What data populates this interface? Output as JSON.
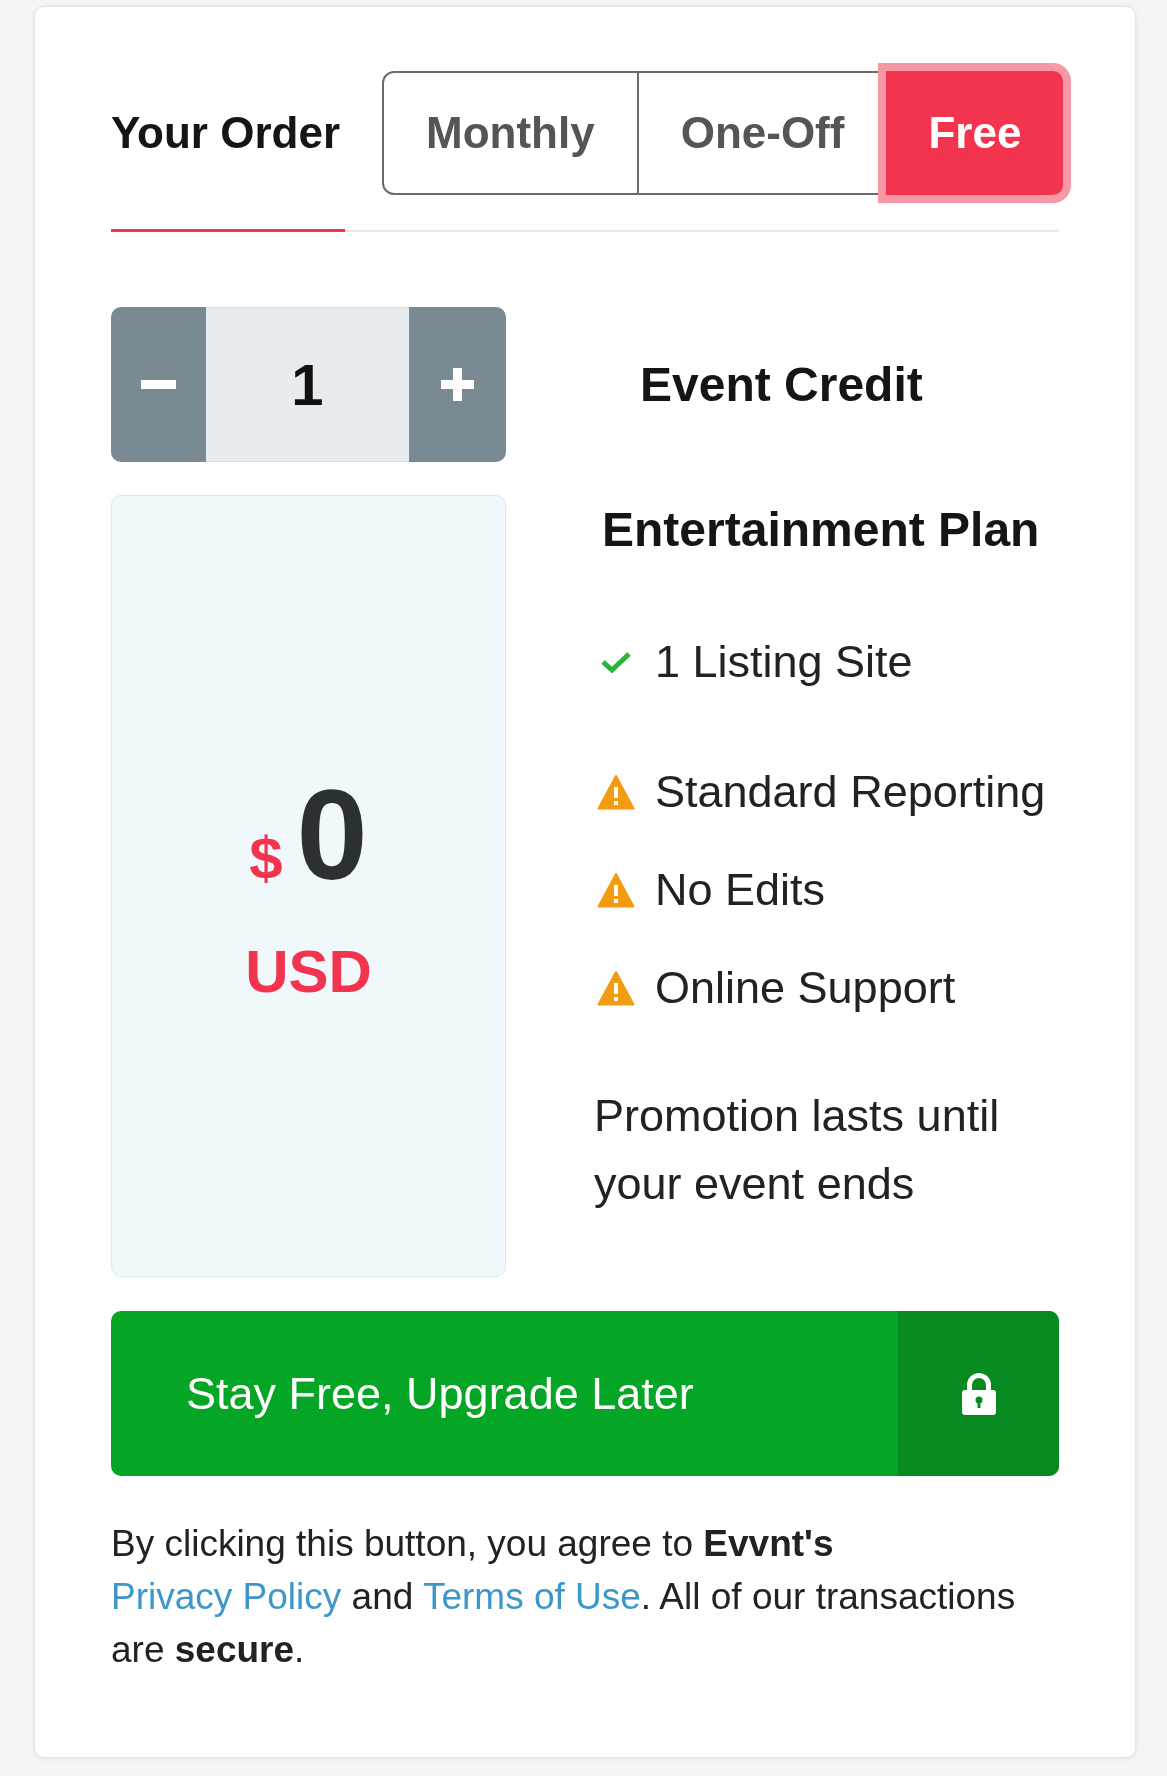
{
  "header": {
    "title": "Your Order"
  },
  "tabs": [
    {
      "label": "Monthly",
      "selected": false
    },
    {
      "label": "One-Off",
      "selected": false
    },
    {
      "label": "Free",
      "selected": true
    }
  ],
  "quantity": {
    "value": "1"
  },
  "product": {
    "title": "Event Credit"
  },
  "price": {
    "currency_symbol": "$",
    "amount": "0",
    "currency": "USD"
  },
  "plan": {
    "title": "Entertainment Plan",
    "features": [
      {
        "kind": "included",
        "text": "1 Listing Site"
      },
      {
        "kind": "limited",
        "text": "Standard Reporting"
      },
      {
        "kind": "limited",
        "text": "No Edits"
      },
      {
        "kind": "limited",
        "text": "Online Support"
      }
    ],
    "note": "Promotion lasts until your event ends"
  },
  "submit_button": {
    "label": "Stay Free, Upgrade Later"
  },
  "disclaimer": {
    "parts": [
      {
        "kind": "text",
        "text": "By clicking this button, you agree to **Evvnt's** "
      },
      {
        "kind": "link",
        "text": "Privacy Policy"
      },
      {
        "kind": "text",
        "text": " and "
      },
      {
        "kind": "link",
        "text": "Terms of Use"
      },
      {
        "kind": "text",
        "text": ". All of our transactions are **secure**."
      }
    ]
  }
}
